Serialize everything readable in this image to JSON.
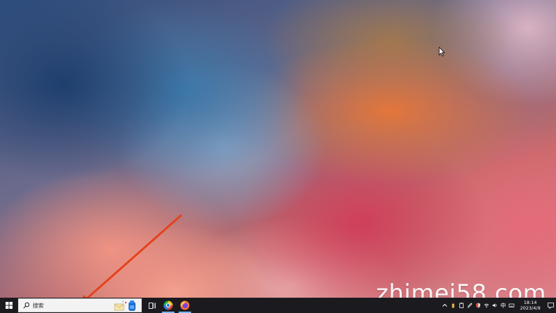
{
  "desktop": {
    "watermark": "zhimei58.com"
  },
  "taskbar": {
    "search": {
      "placeholder": "搜索"
    },
    "apps": [
      {
        "name": "task-view"
      },
      {
        "name": "360-browser"
      },
      {
        "name": "firefox"
      }
    ],
    "clock": {
      "time": "18:14",
      "date": "2023/4/9"
    },
    "ime": "中",
    "colors": {
      "taskbar_bg": "#1b1b1f",
      "search_bg": "#f3f3f3",
      "active_indicator": "#76b9ed",
      "annotation_arrow": "#e4421c"
    }
  }
}
